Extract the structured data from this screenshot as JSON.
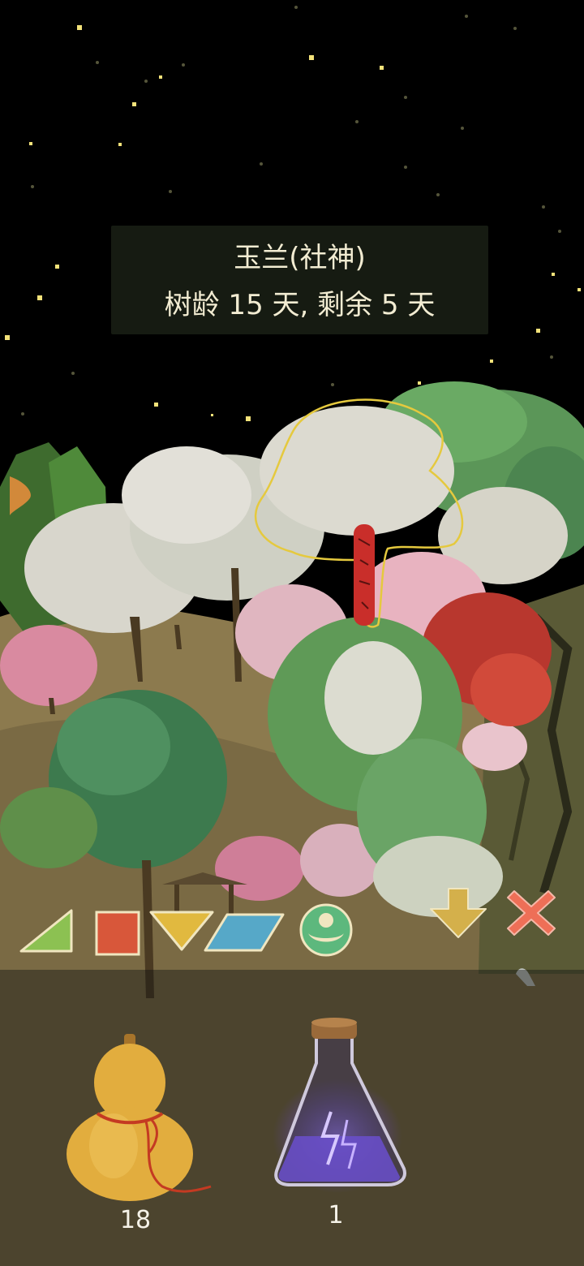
{
  "tree_info": {
    "name": "玉兰(社神)",
    "age": "树龄 15 天, 剩余 5 天"
  },
  "tools": [
    {
      "id": "triangle",
      "icon": "green-triangle-icon",
      "color": "#8cc152"
    },
    {
      "id": "square",
      "icon": "red-square-icon",
      "color": "#d8573a"
    },
    {
      "id": "down-triangle",
      "icon": "yellow-down-triangle-icon",
      "color": "#e1b93f"
    },
    {
      "id": "parallelogram",
      "icon": "blue-parallelogram-icon",
      "color": "#56a8c8"
    },
    {
      "id": "circle",
      "icon": "green-sprout-circle-icon",
      "color": "#5db87d"
    }
  ],
  "actions": {
    "lower_icon": "down-arrow-icon",
    "lower_color": "#d4b04b",
    "close_icon": "close-x-icon",
    "close_color": "#ee6f57"
  },
  "inventory": {
    "gourd": {
      "icon": "gourd-icon",
      "count": "18"
    },
    "potion": {
      "icon": "lightning-potion-icon",
      "count": "1"
    }
  },
  "colors": {
    "sky": "#000000",
    "panel_bg": "#181e14",
    "panel_text": "#f2ecd2",
    "highlight_outline": "#e5c93e",
    "plaque": "#c92e2a"
  }
}
